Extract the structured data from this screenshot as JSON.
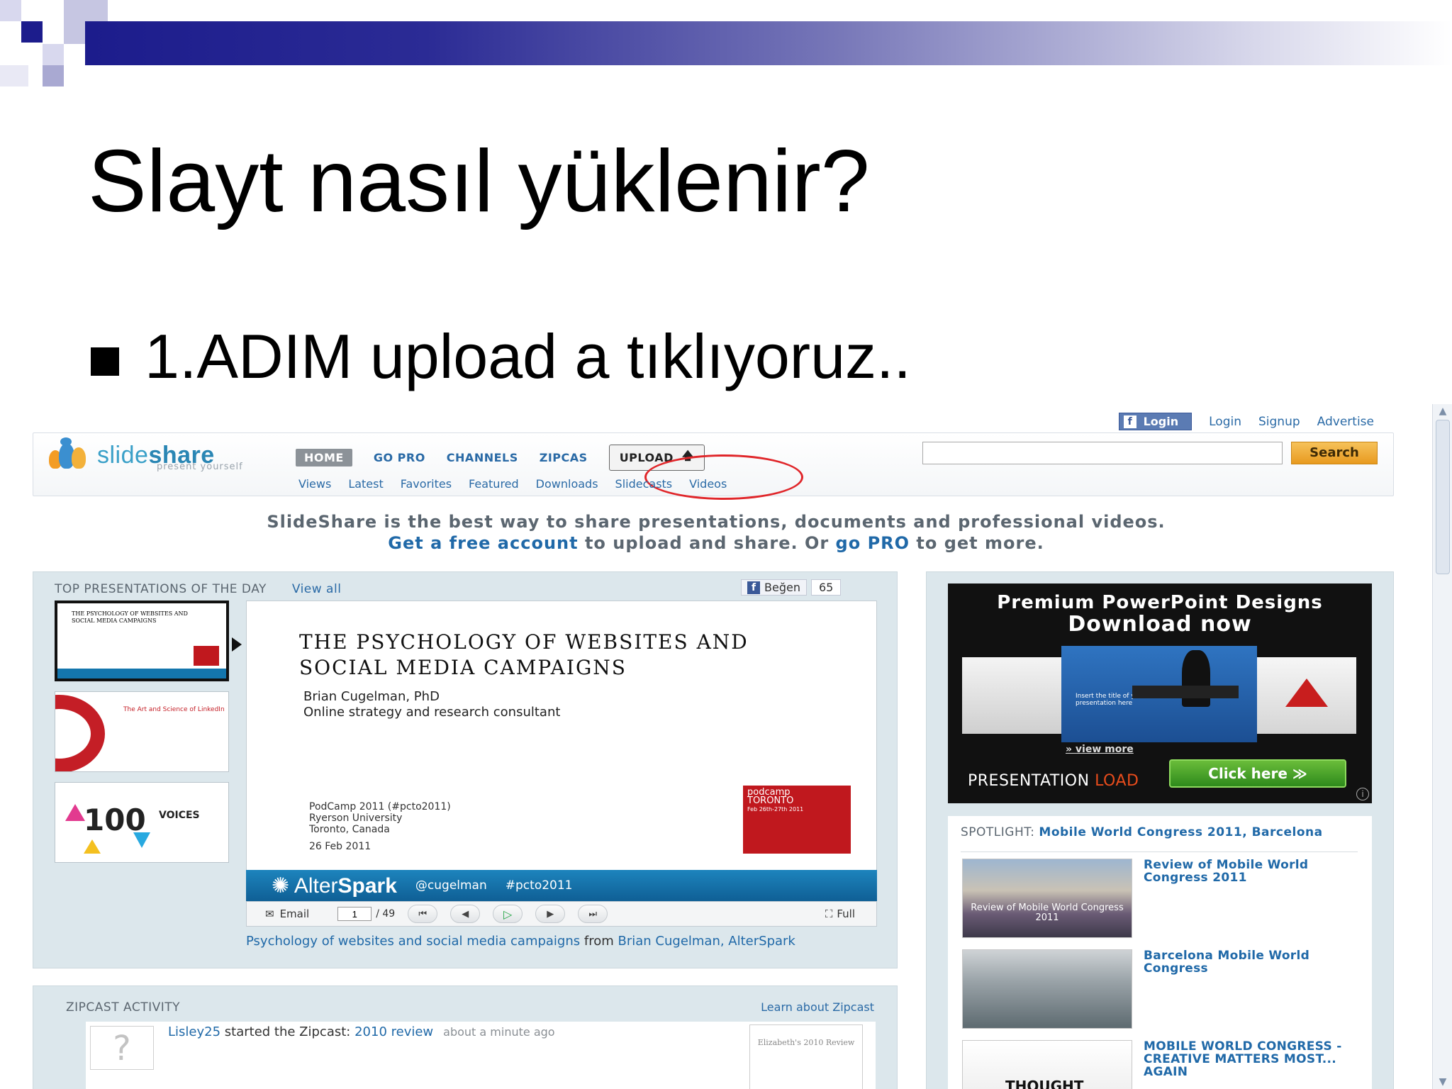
{
  "slide": {
    "title": "Slayt nasıl yüklenir?",
    "bullet": "1.ADIM upload a tıklıyoruz.."
  },
  "site": {
    "toplinks": {
      "fb_login": "Login",
      "login": "Login",
      "signup": "Signup",
      "advertise": "Advertise"
    },
    "logo": {
      "word_light": "slide",
      "word_bold": "share",
      "tagline": "present yourself"
    },
    "nav": {
      "home": "HOME",
      "gopro": "GO PRO",
      "channels": "CHANNELS",
      "zipcasts": "ZIPCAS",
      "upload": "UPLOAD"
    },
    "search": {
      "value": "",
      "button": "Search"
    },
    "subnav": [
      "Views",
      "Latest",
      "Favorites",
      "Featured",
      "Downloads",
      "Slidecasts",
      "Videos"
    ],
    "tagline": {
      "line1": "SlideShare is the best way to share presentations, documents and professional videos.",
      "link1": "Get a free account",
      "mid": " to upload and share. Or ",
      "link2": "go PRO",
      "end": " to get more."
    }
  },
  "top": {
    "heading": "TOP PRESENTATIONS OF THE DAY",
    "view_all": "View all",
    "like_label": "Beğen",
    "like_count": "65",
    "thumbs": [
      {
        "text": "THE PSYCHOLOGY OF WEBSITES AND SOCIAL MEDIA CAMPAIGNS"
      },
      {
        "text": "The Art and Science of LinkedIn"
      },
      {
        "num": "100",
        "text": "VOICES"
      }
    ],
    "deck": {
      "title_line1": "THE PSYCHOLOGY OF WEBSITES AND",
      "title_line2": "SOCIAL MEDIA CAMPAIGNS",
      "author": "Brian Cugelman, PhD",
      "role": "Online strategy and research consultant",
      "event1": "PodCamp 2011 (#pcto2011)",
      "event2": "Ryerson University",
      "event3": "Toronto, Canada",
      "date": "26 Feb 2011",
      "logo1": "podcamp",
      "logo2": "TORONTO",
      "logo3": "Feb 26th-27th 2011"
    },
    "bar": {
      "brand_a": "Alter",
      "brand_b": "Spark",
      "handle": "@cugelman",
      "tag": "#pcto2011"
    },
    "controls": {
      "email": "Email",
      "page": "1",
      "total": "/ 49",
      "full": "Full"
    },
    "caption": {
      "link": "Psychology of websites and social media campaigns",
      "from": " from ",
      "author": "Brian Cugelman, AlterSpark"
    }
  },
  "zipcast": {
    "heading": "ZIPCAST ACTIVITY",
    "learn": "Learn about Zipcast",
    "user": "Lisley25",
    "action": " started the Zipcast: ",
    "link": "2010 review",
    "ago": "about a minute ago",
    "thumb_text": "Elizabeth's 2010 Review"
  },
  "ad": {
    "line1": "Premium PowerPoint Designs",
    "line2": "Download now",
    "more": "» view more",
    "brand_a": "PRESENTATION",
    "brand_b": "LOAD",
    "click": "Click here ≫",
    "inset": "Insert the title of your presentation here"
  },
  "spotlight": {
    "prefix": "SPOTLIGHT: ",
    "title": "Mobile World Congress 2011, Barcelona",
    "items": [
      {
        "title": "Review of Mobile World Congress 2011",
        "img_text": "Review of Mobile World Congress 2011"
      },
      {
        "title": "Barcelona Mobile World Congress"
      },
      {
        "title": "MOBILE WORLD CONGRESS - CREATIVE MATTERS MOST... AGAIN",
        "img_text": "THOUGHT"
      }
    ]
  }
}
